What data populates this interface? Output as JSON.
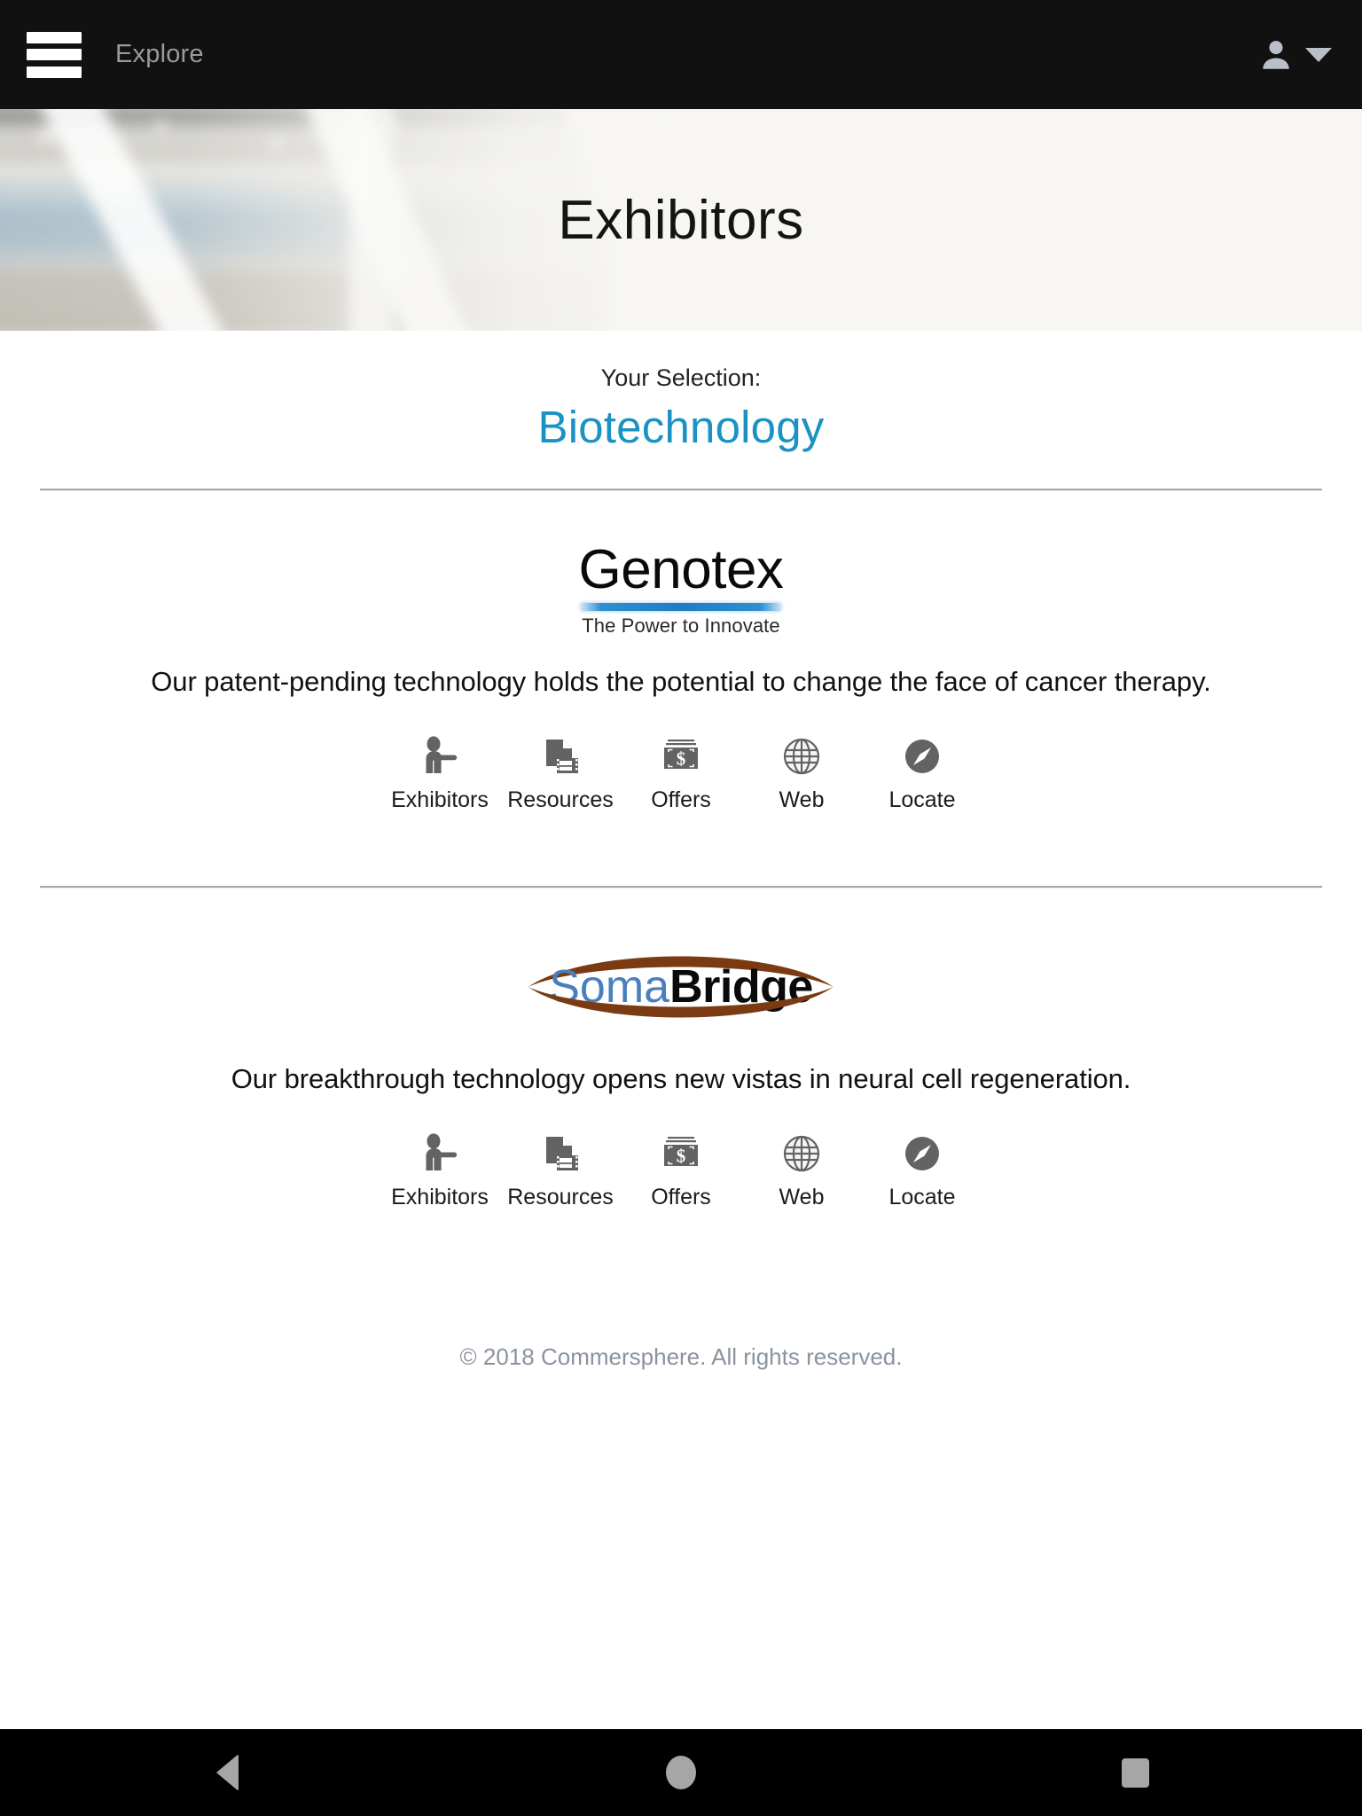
{
  "appbar": {
    "menu_icon": "hamburger-icon",
    "title": "Explore",
    "account_icon": "user-avatar-icon",
    "caret_icon": "chevron-down-icon"
  },
  "hero": {
    "title": "Exhibitors"
  },
  "selection": {
    "label": "Your Selection:",
    "value": "Biotechnology",
    "accent_color": "#1a93c4"
  },
  "actions": [
    {
      "icon": "exhibitor-person-icon",
      "label": "Exhibitors"
    },
    {
      "icon": "document-media-icon",
      "label": "Resources"
    },
    {
      "icon": "banknote-dollar-icon",
      "label": "Offers"
    },
    {
      "icon": "globe-icon",
      "label": "Web"
    },
    {
      "icon": "compass-icon",
      "label": "Locate"
    }
  ],
  "exhibitors": [
    {
      "logo": {
        "type": "genotex",
        "name": "Genotex",
        "tagline": "The Power to Innovate",
        "bar_color": "#1f7cc2"
      },
      "description": "Our patent-pending technology holds the potential to change the face of cancer therapy."
    },
    {
      "logo": {
        "type": "somabridge",
        "name_part1": "Soma",
        "name_part2": "Bridge",
        "part1_color": "#4a7fbd",
        "part2_color": "#0a0a0a",
        "arc_color": "#7a3a12"
      },
      "description": "Our breakthrough technology opens new vistas in neural cell regeneration."
    }
  ],
  "footer": {
    "copyright": "© 2018 Commersphere. All rights reserved."
  },
  "navbar": {
    "back": "back-triangle-icon",
    "home": "home-circle-icon",
    "recents": "recents-square-icon"
  }
}
